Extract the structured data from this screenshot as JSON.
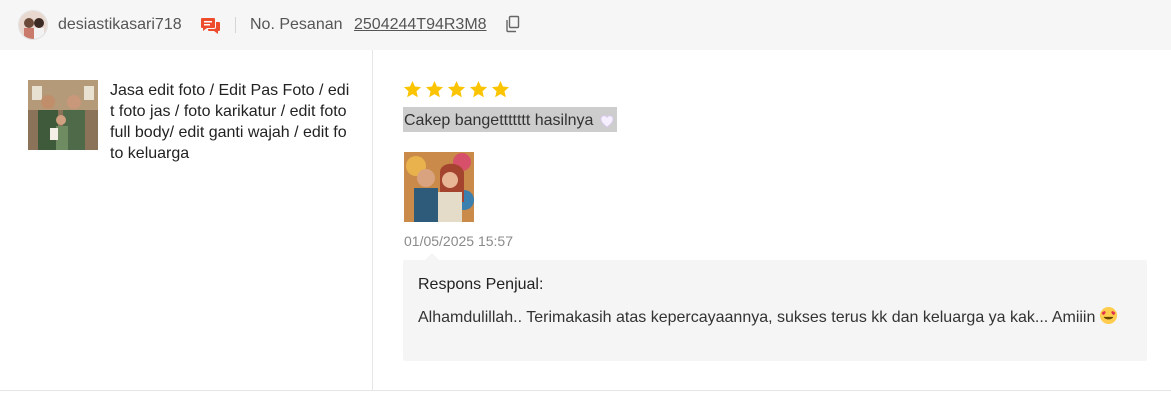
{
  "header": {
    "username": "desiastikasari718",
    "order_label": "No. Pesanan",
    "order_id": "2504244T94R3M8",
    "icons": {
      "avatar": "user-avatar",
      "chat": "chat-icon",
      "copy": "copy-icon"
    },
    "colors": {
      "chat": "#ee4d2d",
      "background": "#f6f6f6"
    }
  },
  "product": {
    "title": "Jasa edit foto / Edit Pas Foto / edit foto jas / foto karikatur / edit foto full body/ edit ganti wajah / edit foto keluarga",
    "thumbnail": "family-portrait-thumbnail"
  },
  "review": {
    "rating": 5,
    "max_rating": 5,
    "star_color": "#fbc400",
    "text": "Cakep bangettttttt hasilnya",
    "text_emoji": "white-heart",
    "photo": "couple-portrait-photo",
    "timestamp": "01/05/2025 15:57"
  },
  "seller_response": {
    "title": "Respons Penjual:",
    "text": "Alhamdulillah.. Terimakasih atas kepercayaannya, sukses terus kk dan keluarga ya kak... Amiiin",
    "emoji": "heart-eyes-face"
  }
}
